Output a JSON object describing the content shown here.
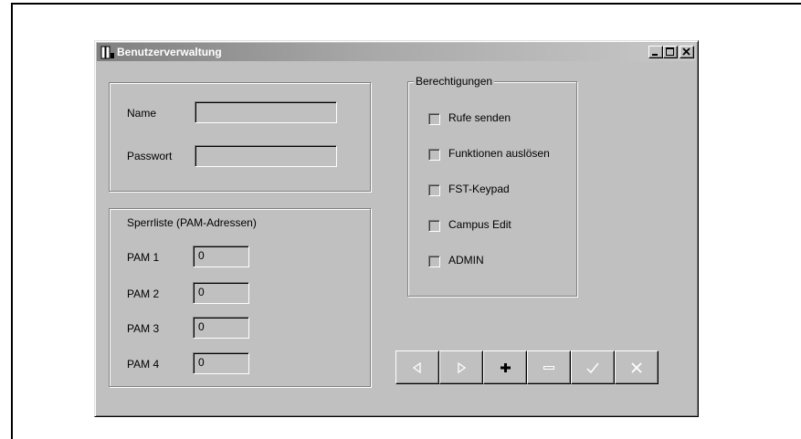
{
  "window": {
    "title": "Benutzerverwaltung"
  },
  "title_buttons": [
    {
      "name": "minimize-button",
      "icon": "minimize-icon"
    },
    {
      "name": "maximize-button",
      "icon": "maximize-icon"
    },
    {
      "name": "close-button",
      "icon": "close-icon"
    }
  ],
  "credentials": {
    "name_label": "Name",
    "name_value": "",
    "password_label": "Passwort",
    "password_value": ""
  },
  "blocklist": {
    "title": "Sperrliste (PAM-Adressen)",
    "items": [
      {
        "label": "PAM 1",
        "value": "0"
      },
      {
        "label": "PAM 2",
        "value": "0"
      },
      {
        "label": "PAM 3",
        "value": "0"
      },
      {
        "label": "PAM 4",
        "value": "0"
      }
    ]
  },
  "permissions": {
    "title": "Berechtigungen",
    "items": [
      {
        "label": "Rufe senden",
        "checked": false
      },
      {
        "label": "Funktionen auslösen",
        "checked": false
      },
      {
        "label": "FST-Keypad",
        "checked": false
      },
      {
        "label": "Campus Edit",
        "checked": false
      },
      {
        "label": "ADMIN",
        "checked": false
      }
    ]
  },
  "navigator": [
    {
      "name": "prior-button",
      "icon": "triangle-left-icon",
      "enabled": false
    },
    {
      "name": "next-button",
      "icon": "triangle-right-icon",
      "enabled": false
    },
    {
      "name": "insert-button",
      "icon": "plus-icon",
      "enabled": true
    },
    {
      "name": "delete-button",
      "icon": "minus-icon",
      "enabled": false
    },
    {
      "name": "post-button",
      "icon": "checkmark-icon",
      "enabled": false
    },
    {
      "name": "cancel-button",
      "icon": "cross-icon",
      "enabled": false
    }
  ],
  "colors": {
    "face": "#c0c0c0",
    "disabled_glyph": "#ffffff",
    "active_glyph": "#000000"
  }
}
